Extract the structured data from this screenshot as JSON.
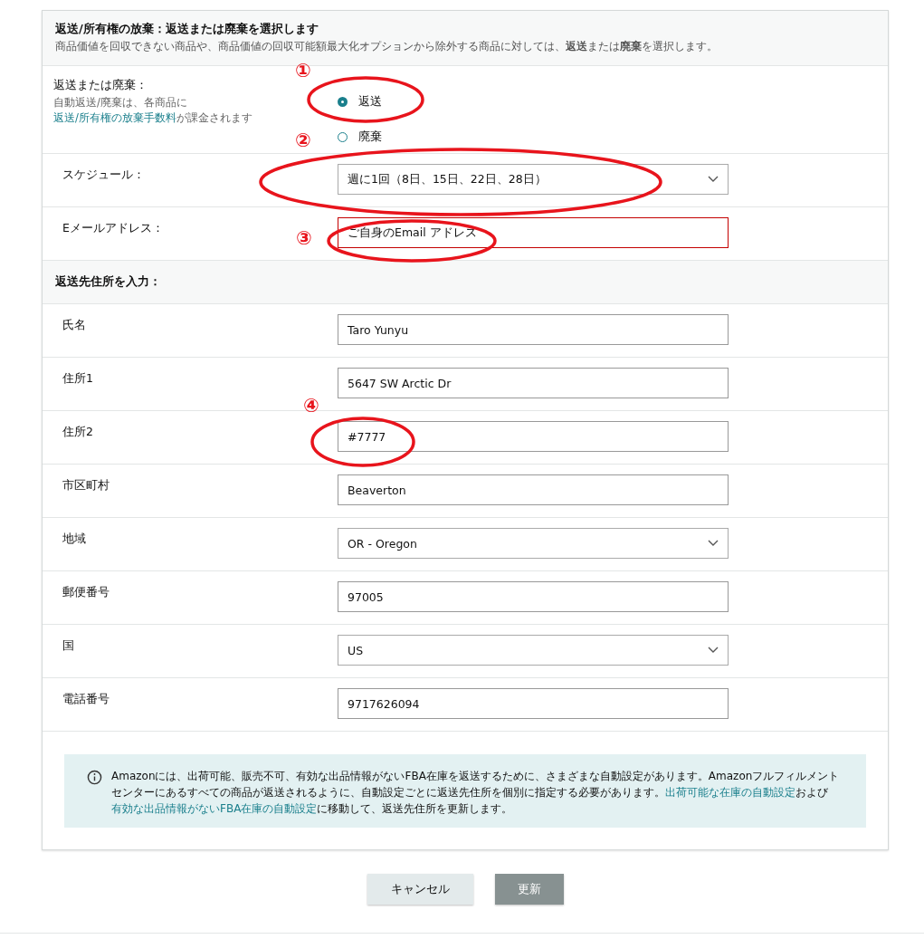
{
  "panel": {
    "title": "返送/所有権の放棄：返送または廃棄を選択します",
    "subtitle": "商品価値を回収できない商品や、商品価値の回収可能額最大化オプションから除外する商品に対しては、**返送**または**廃棄**を選択します。"
  },
  "disposition": {
    "label": "返送または廃棄：",
    "hint": [
      {
        "kind": "text",
        "text": "自動返送/廃棄は、各商品に"
      },
      {
        "kind": "link",
        "text": "返送/所有権の放棄手数料"
      },
      {
        "kind": "text",
        "text": "が課金されます"
      }
    ],
    "options": [
      {
        "label": "返送",
        "selected": true
      },
      {
        "label": "廃棄",
        "selected": false
      }
    ]
  },
  "schedule": {
    "label": "スケジュール：",
    "value": "週に1回（8日、15日、22日、28日）"
  },
  "email": {
    "label": "Eメールアドレス：",
    "value": "ご自身のEmail アドレス",
    "invalid": true
  },
  "address_heading": "返送先住所を入力：",
  "address_fields": [
    {
      "label": "氏名",
      "value": "Taro Yunyu",
      "kind": "text"
    },
    {
      "label": "住所1",
      "value": "5647 SW Arctic Dr",
      "kind": "text"
    },
    {
      "label": "住所2",
      "value": "#7777",
      "kind": "text"
    },
    {
      "label": "市区町村",
      "value": "Beaverton",
      "kind": "text"
    },
    {
      "label": "地域",
      "value": "OR - Oregon",
      "kind": "select"
    },
    {
      "label": "郵便番号",
      "value": "97005",
      "kind": "text"
    },
    {
      "label": "国",
      "value": "US",
      "kind": "select"
    },
    {
      "label": "電話番号",
      "value": "9717626094",
      "kind": "text"
    }
  ],
  "info": [
    {
      "kind": "text",
      "text": "Amazonには、出荷可能、販売不可、有効な出品情報がないFBA在庫を返送するために、さまざまな自動設定があります。Amazonフルフィルメントセンターにあるすべての商品が返送されるように、自動設定ごとに返送先住所を個別に指定する必要があります。"
    },
    {
      "kind": "link",
      "text": "出荷可能な在庫の自動設定"
    },
    {
      "kind": "text",
      "text": "および"
    },
    {
      "kind": "link",
      "text": "有効な出品情報がないFBA在庫の自動設定"
    },
    {
      "kind": "text",
      "text": "に移動して、返送先住所を更新します。"
    }
  ],
  "buttons": [
    {
      "label": "キャンセル",
      "kind": "secondary"
    },
    {
      "label": "更新",
      "kind": "primary"
    }
  ],
  "annotations": [
    {
      "number": "①"
    },
    {
      "number": "②"
    },
    {
      "number": "③"
    },
    {
      "number": "④"
    }
  ]
}
